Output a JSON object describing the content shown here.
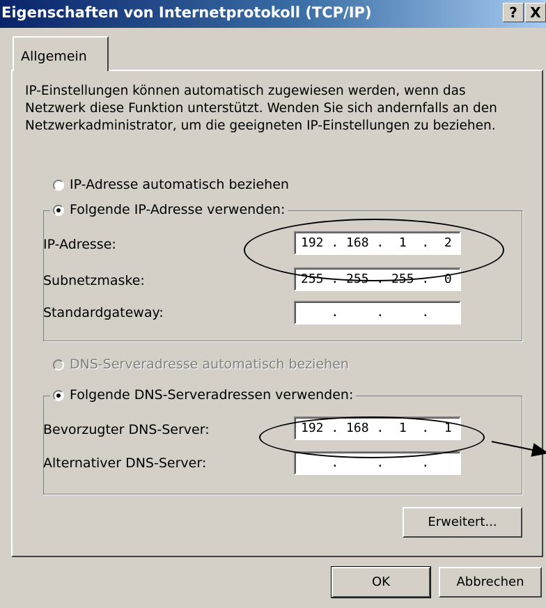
{
  "window": {
    "title": "Eigenschaften von Internetprotokoll (TCP/IP)",
    "help_button": "?",
    "close_button": "X"
  },
  "tab": {
    "label": "Allgemein"
  },
  "description": "IP-Einstellungen können automatisch zugewiesen werden, wenn das Netzwerk diese Funktion unterstützt. Wenden Sie sich andernfalls an den Netzwerkadministrator, um die geeigneten IP-Einstellungen zu beziehen.",
  "ip_section": {
    "auto_option": "IP-Adresse automatisch beziehen",
    "manual_option": "Folgende IP-Adresse verwenden:",
    "selected": "manual",
    "fields": [
      {
        "label": "IP-Adresse:",
        "value": "192 . 168 .  1  .  2"
      },
      {
        "label": "Subnetzmaske:",
        "value": "255 . 255 . 255 .  0"
      },
      {
        "label": "Standardgateway:",
        "value": "    .     .     ."
      }
    ]
  },
  "dns_section": {
    "auto_option": "DNS-Serveradresse automatisch beziehen",
    "auto_disabled": true,
    "manual_option": "Folgende DNS-Serveradressen verwenden:",
    "selected": "manual",
    "fields": [
      {
        "label": "Bevorzugter DNS-Server:",
        "value": "192 . 168 .  1  .  1"
      },
      {
        "label": "Alternativer DNS-Server:",
        "value": "    .     .     ."
      }
    ]
  },
  "buttons": {
    "advanced": "Erweitert...",
    "ok": "OK",
    "cancel": "Abbrechen"
  },
  "colors": {
    "dialog_bg": "#d4d0c8",
    "titlebar_start": "#0a246a",
    "titlebar_end": "#a6caf0"
  }
}
